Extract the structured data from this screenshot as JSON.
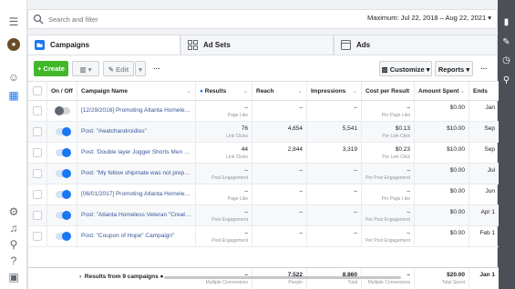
{
  "search": {
    "placeholder": "Search and filter"
  },
  "date_range": "Maximum: Jul 22, 2018 – Aug 22, 2021",
  "tabs": [
    {
      "label": "Campaigns",
      "icon": "folder-icon"
    },
    {
      "label": "Ad Sets",
      "icon": "grid-icon"
    },
    {
      "label": "Ads",
      "icon": "ad-icon"
    }
  ],
  "toolbar": {
    "create_label": "+ Create",
    "edit_label": "Edit",
    "more_label": "···",
    "customize_label": "Customize",
    "reports_label": "Reports",
    "overflow_label": "···"
  },
  "columns": {
    "onoff": "On / Off",
    "name": "Campaign Name",
    "results": "Results",
    "reach": "Reach",
    "impressions": "Impressions",
    "cost": "Cost per Result",
    "spent": "Amount Spent",
    "ends": "Ends"
  },
  "rows": [
    {
      "on": false,
      "name": "[12/29/2016] Promoting Atlanta Homeless V...",
      "results": "–",
      "results_sub": "Page Like",
      "reach": "–",
      "impressions": "–",
      "cost": "–",
      "cost_sub": "Per Page Like",
      "spent": "$0.00",
      "ends": "Jan"
    },
    {
      "on": true,
      "name": "Post: \"#watchandroidios\"",
      "results": "76",
      "results_sub": "Link Clicks",
      "reach": "4,654",
      "impressions": "5,541",
      "cost": "$0.13",
      "cost_sub": "Per Link Click",
      "spent": "$10.00",
      "ends": "Sep"
    },
    {
      "on": true,
      "name": "Post: 'Double layer Jogger Shorts Men 2 in 1 ...",
      "results": "44",
      "results_sub": "Link Clicks",
      "reach": "2,844",
      "impressions": "3,319",
      "cost": "$0.23",
      "cost_sub": "Per Link Click",
      "spent": "$10.00",
      "ends": "Sep"
    },
    {
      "on": true,
      "name": "Post: \"My fellow shipmate was not prepared f...",
      "results": "–",
      "results_sub": "Post Engagement",
      "reach": "–",
      "impressions": "–",
      "cost": "–",
      "cost_sub": "Per Post Engagement",
      "spent": "$0.00",
      "ends": "Jul"
    },
    {
      "on": true,
      "name": "[06/01/2017] Promoting Atlanta Homeless V...",
      "results": "–",
      "results_sub": "Page Like",
      "reach": "–",
      "impressions": "–",
      "cost": "–",
      "cost_sub": "Per Page Like",
      "spent": "$0.00",
      "ends": "Jun"
    },
    {
      "on": true,
      "name": "Post: \"Atlanta Homeless Veteran \"Creating A ...",
      "results": "–",
      "results_sub": "Post Engagement",
      "reach": "–",
      "impressions": "–",
      "cost": "–",
      "cost_sub": "Per Post Engagement",
      "spent": "$0.00",
      "ends": "Apr 1"
    },
    {
      "on": true,
      "name": "Post: \"Coupon of Hope\" Campaign\"",
      "results": "–",
      "results_sub": "Post Engagement",
      "reach": "–",
      "impressions": "–",
      "cost": "–",
      "cost_sub": "Per Post Engagement",
      "spent": "$0.00",
      "ends": "Feb 1"
    }
  ],
  "footer": {
    "label": "Results from 9 campaigns",
    "results": "–",
    "results_sub": "Multiple Conversions",
    "reach": "7,522",
    "reach_sub": "People",
    "impressions": "8,860",
    "impressions_sub": "Total",
    "cost": "–",
    "cost_sub": "Multiple Conversions",
    "spent": "$20.00",
    "spent_sub": "Total Spent",
    "ends": "Jan 1"
  },
  "colors": {
    "accent": "#1877f2",
    "create": "#42b72a",
    "link": "#385898"
  }
}
